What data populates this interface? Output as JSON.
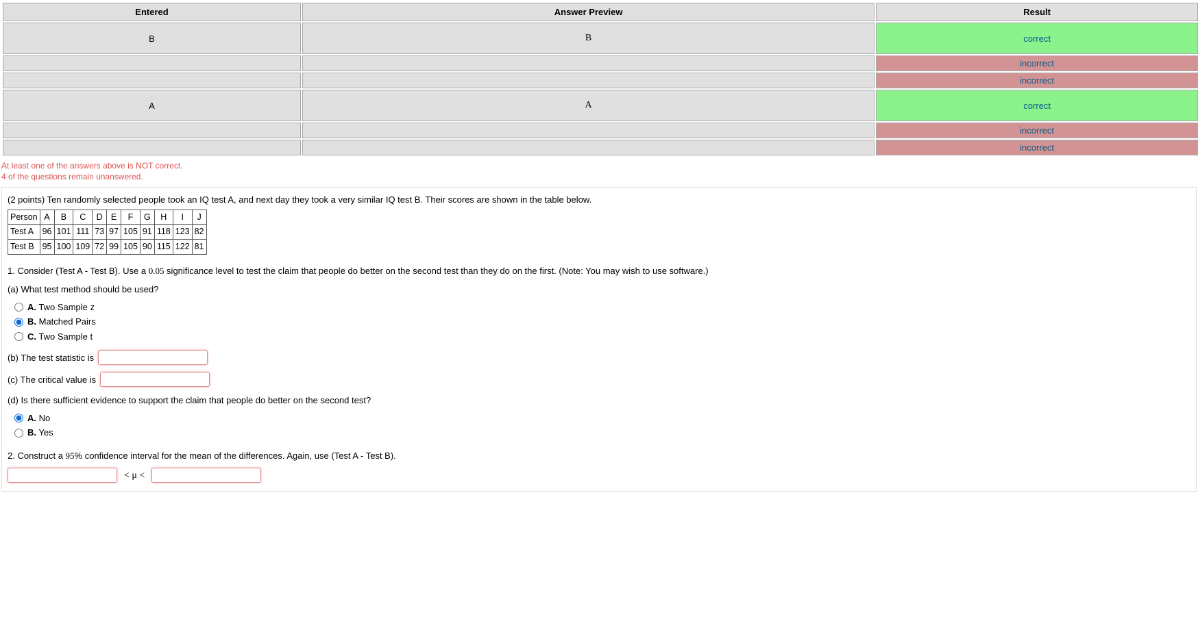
{
  "results": {
    "headers": [
      "Entered",
      "Answer Preview",
      "Result"
    ],
    "rows": [
      {
        "entered": "B",
        "preview": "B",
        "result": "correct",
        "tall": true
      },
      {
        "entered": "",
        "preview": "",
        "result": "incorrect",
        "tall": false
      },
      {
        "entered": "",
        "preview": "",
        "result": "incorrect",
        "tall": false
      },
      {
        "entered": "A",
        "preview": "A",
        "result": "correct",
        "tall": true
      },
      {
        "entered": "",
        "preview": "",
        "result": "incorrect",
        "tall": false
      },
      {
        "entered": "",
        "preview": "",
        "result": "incorrect",
        "tall": false
      }
    ]
  },
  "warnings": {
    "line1": "At least one of the answers above is NOT correct.",
    "line2": "4 of the questions remain unanswered."
  },
  "problem": {
    "intro_pre": "(2 points) Ten randomly selected people took an IQ test A, and next day they took a very similar IQ test B. Their scores are shown in the table below.",
    "table": {
      "row_headers": [
        "Person",
        "Test A",
        "Test B"
      ],
      "persons": [
        "A",
        "B",
        "C",
        "D",
        "E",
        "F",
        "G",
        "H",
        "I",
        "J"
      ],
      "testA": [
        "96",
        "101",
        "111",
        "73",
        "97",
        "105",
        "91",
        "118",
        "123",
        "82"
      ],
      "testB": [
        "95",
        "100",
        "109",
        "72",
        "99",
        "105",
        "90",
        "115",
        "122",
        "81"
      ]
    },
    "q1": {
      "text_pre": "1. Consider (Test A - Test B). Use a ",
      "sig": "0.05",
      "text_post": " significance level to test the claim that people do better on the second test than they do on the first. (Note: You may wish to use software.)",
      "a_prompt": "(a) What test method should be used?",
      "choices_a": [
        {
          "key": "A",
          "label": "Two Sample z",
          "checked": false
        },
        {
          "key": "B",
          "label": "Matched Pairs",
          "checked": true
        },
        {
          "key": "C",
          "label": "Two Sample t",
          "checked": false
        }
      ],
      "b_prompt": "(b) The test statistic is",
      "b_value": "",
      "c_prompt": "(c) The critical value is",
      "c_value": "",
      "d_prompt": "(d) Is there sufficient evidence to support the claim that people do better on the second test?",
      "choices_d": [
        {
          "key": "A",
          "label": "No",
          "checked": true
        },
        {
          "key": "B",
          "label": "Yes",
          "checked": false
        }
      ]
    },
    "q2": {
      "text_pre": "2. Construct a ",
      "pct": "95",
      "text_post": "% confidence interval for the mean of the differences. Again, use (Test A - Test B).",
      "low": "",
      "mu_sym": "< μ <",
      "high": ""
    }
  }
}
